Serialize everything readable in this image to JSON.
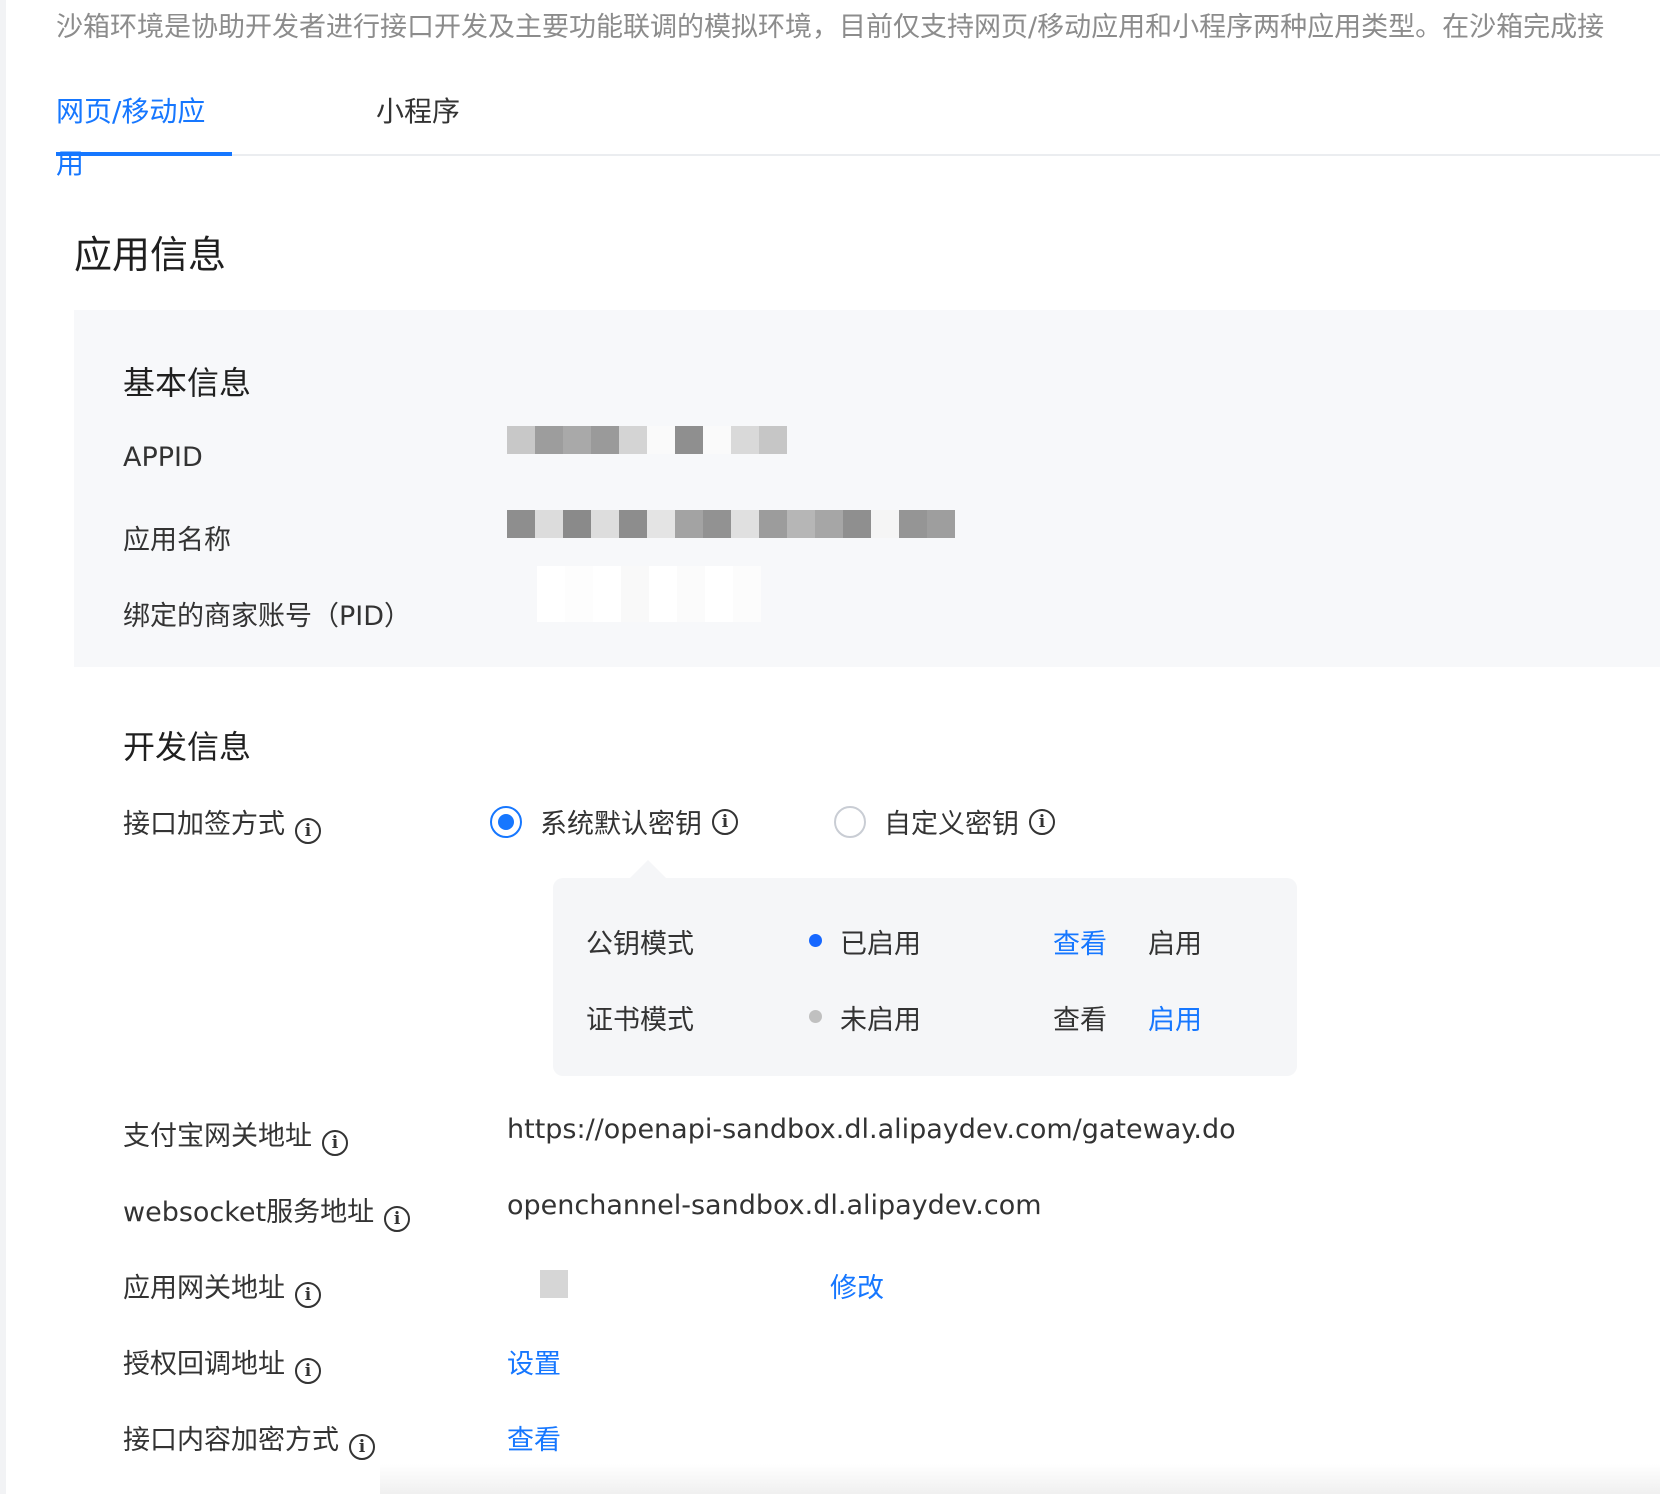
{
  "intro_text": "沙箱环境是协助开发者进行接口开发及主要功能联调的模拟环境，目前仅支持网页/移动应用和小程序两种应用类型。在沙箱完成接",
  "tabs": [
    {
      "label": "网页/移动应用",
      "active": true
    },
    {
      "label": "小程序",
      "active": false
    }
  ],
  "page_title": "应用信息",
  "basic": {
    "title": "基本信息",
    "appid_label": "APPID",
    "app_name_label": "应用名称",
    "pid_label": "绑定的商家账号（PID）"
  },
  "dev": {
    "title": "开发信息",
    "sign_method_label": "接口加签方式",
    "sign_options": [
      {
        "label": "系统默认密钥",
        "checked": true
      },
      {
        "label": "自定义密钥",
        "checked": false
      }
    ],
    "modes": [
      {
        "name": "公钥模式",
        "status": "已启用",
        "status_color": "#1667ff",
        "view": "查看",
        "view_is_link": true,
        "enable": "启用",
        "enable_is_link": false
      },
      {
        "name": "证书模式",
        "status": "未启用",
        "status_color": "#c0c0c0",
        "view": "查看",
        "view_is_link": false,
        "enable": "启用",
        "enable_is_link": true
      }
    ],
    "gateway_label": "支付宝网关地址",
    "gateway_value": "https://openapi-sandbox.dl.alipaydev.com/gateway.do",
    "websocket_label": "websocket服务地址",
    "websocket_value": "openchannel-sandbox.dl.alipaydev.com",
    "app_gateway_label": "应用网关地址",
    "app_gateway_action": "修改",
    "auth_callback_label": "授权回调地址",
    "auth_callback_action": "设置",
    "encrypt_label": "接口内容加密方式",
    "encrypt_action": "查看"
  },
  "colors": {
    "accent": "#1677ff",
    "text": "#333333",
    "muted": "#8c8c8c",
    "panel": "#f7f8fa"
  }
}
